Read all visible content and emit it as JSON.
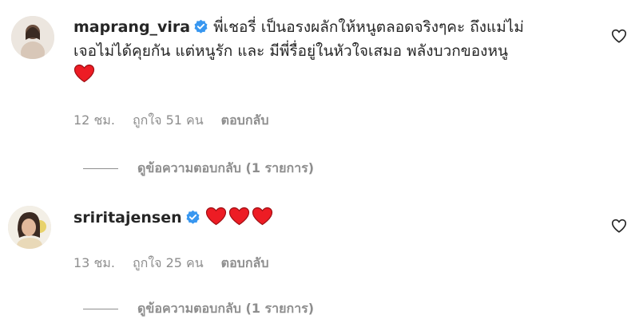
{
  "comments": [
    {
      "username": "maprang_vira",
      "text_line1": "พี่เชอรี่ เป็นอรงผลักให้หนูตลอดจริงๆคะ ถึงแม่ไม่",
      "text_line2": "เจอไม่ได้คุยกัน แต่หนูรัก และ มีพี่รื่อยู่ในหัวใจเสมอ พลังบวกของหนู",
      "time": "12 ชม.",
      "likes": "ถูกใจ 51 คน",
      "reply_label": "ตอบกลับ",
      "view_replies": "ดูข้อความตอบกลับ (1 รายการ)"
    },
    {
      "username": "sriritajensen",
      "time": "13 ชม.",
      "likes": "ถูกใจ 25 คน",
      "reply_label": "ตอบกลับ",
      "view_replies": "ดูข้อความตอบกลับ (1 รายการ)"
    }
  ],
  "colors": {
    "text": "#262626",
    "secondary": "#8e8e8e",
    "verified": "#3897f0",
    "heart": "#ed1c24"
  },
  "icons": [
    "verified-badge-icon",
    "red-heart-emoji-icon",
    "heart-outline-icon"
  ]
}
